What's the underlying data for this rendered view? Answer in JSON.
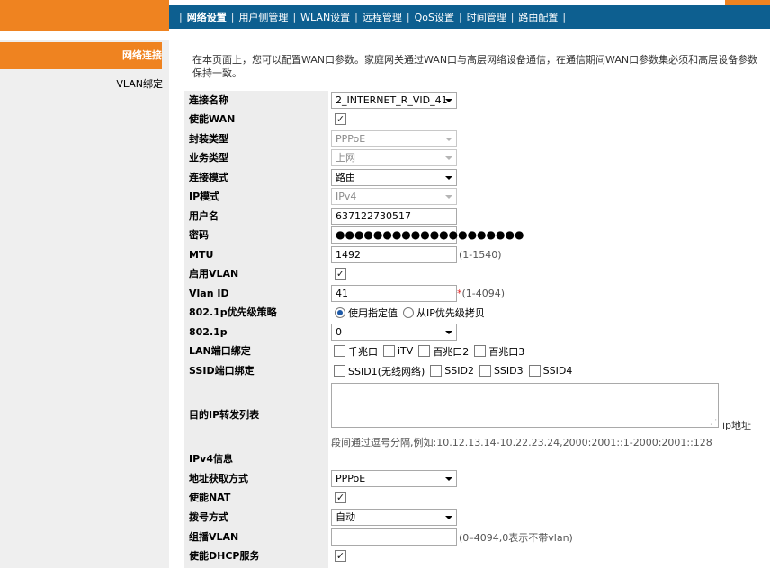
{
  "nav": {
    "items": [
      "网络设置",
      "用户侧管理",
      "WLAN设置",
      "远程管理",
      "QoS设置",
      "时间管理",
      "路由配置"
    ],
    "separator": "|"
  },
  "sidebar": {
    "items": [
      "网络连接",
      "VLAN绑定"
    ]
  },
  "intro_text": "在本页面上，您可以配置WAN口参数。家庭网关通过WAN口与高层网络设备通信，在通信期间WAN口参数集必须和高层设备参数保持一致。",
  "form": {
    "connection_name": {
      "label": "连接名称",
      "value": "2_INTERNET_R_VID_41"
    },
    "enable_wan": {
      "label": "使能WAN",
      "checked": true
    },
    "encap_type": {
      "label": "封装类型",
      "value": "PPPoE"
    },
    "service_type": {
      "label": "业务类型",
      "value": "上网"
    },
    "conn_mode": {
      "label": "连接模式",
      "value": "路由"
    },
    "ip_mode": {
      "label": "IP模式",
      "value": "IPv4"
    },
    "username": {
      "label": "用户名",
      "value": "637122730517"
    },
    "password": {
      "label": "密码",
      "value": "●●●●●●●●●●●●●●●●●●●●"
    },
    "mtu": {
      "label": "MTU",
      "value": "1492",
      "hint": "(1-1540)"
    },
    "enable_vlan": {
      "label": "启用VLAN",
      "checked": true
    },
    "vlan_id": {
      "label": "Vlan ID",
      "value": "41",
      "required_mark": "*",
      "hint": "(1-4094)"
    },
    "priority_policy": {
      "label": "802.1p优先级策略",
      "option1": "使用指定值",
      "option2": "从IP优先级拷贝",
      "selected": "使用指定值"
    },
    "dot1p": {
      "label": "802.1p",
      "value": "0"
    },
    "lan_binding": {
      "label": "LAN端口绑定",
      "options": [
        "千兆口",
        "iTV",
        "百兆口2",
        "百兆口3"
      ]
    },
    "ssid_binding": {
      "label": "SSID端口绑定",
      "options": [
        "SSID1(无线网络)",
        "SSID2",
        "SSID3",
        "SSID4"
      ]
    },
    "dest_ip_list": {
      "label": "目的IP转发列表",
      "suffix": "ip地址",
      "hint": "段间通过逗号分隔,例如:10.12.13.14-10.22.23.24,2000:2001::1-2000:2001::128"
    },
    "ipv4_info": {
      "label": "IPv4信息"
    },
    "addr_method": {
      "label": "地址获取方式",
      "value": "PPPoE"
    },
    "enable_nat": {
      "label": "使能NAT",
      "checked": true
    },
    "dial_mode": {
      "label": "拨号方式",
      "value": "自动"
    },
    "multicast_vlan": {
      "label": "组播VLAN",
      "value": "",
      "hint": "(0–4094,0表示不带vlan)"
    },
    "enable_dhcp": {
      "label": "使能DHCP服务",
      "checked": true
    }
  },
  "icons": {
    "check": "✓",
    "resize_grip": "⋰"
  }
}
